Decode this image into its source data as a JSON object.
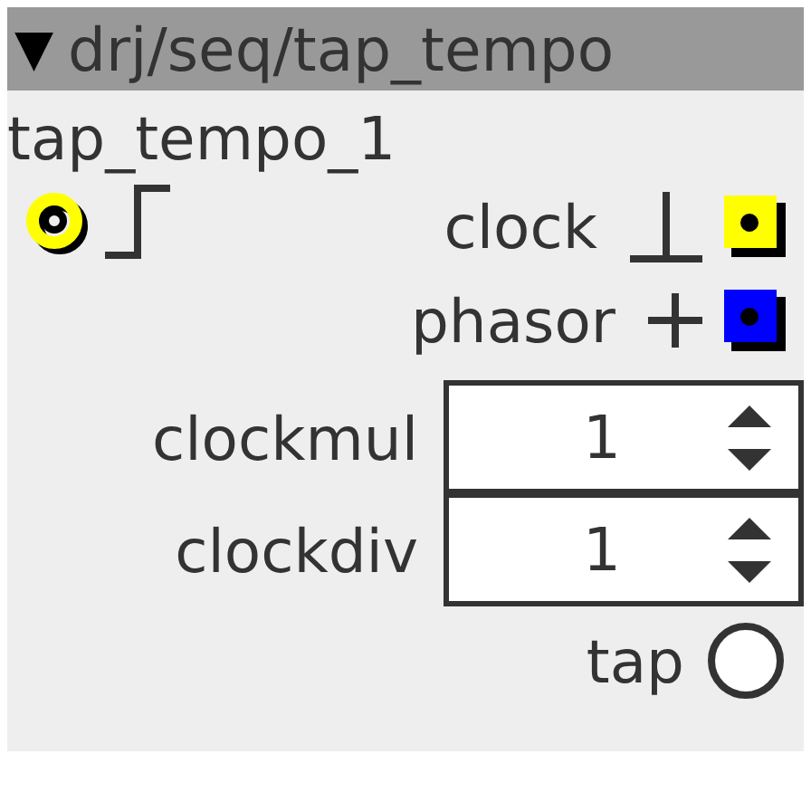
{
  "header": {
    "arrow": "▼",
    "title": "drj/seq/tap_tempo"
  },
  "instance": "tap_tempo_1",
  "inlets": [
    {
      "kind": "trigger"
    }
  ],
  "outlets": [
    {
      "label": "clock",
      "kind": "trigger",
      "color": "#ffff00"
    },
    {
      "label": "phasor",
      "kind": "frac",
      "color": "#0000ff"
    }
  ],
  "params": [
    {
      "label": "clockmul",
      "value": "1"
    },
    {
      "label": "clockdiv",
      "value": "1"
    }
  ],
  "tap": {
    "label": "tap",
    "on": false
  }
}
